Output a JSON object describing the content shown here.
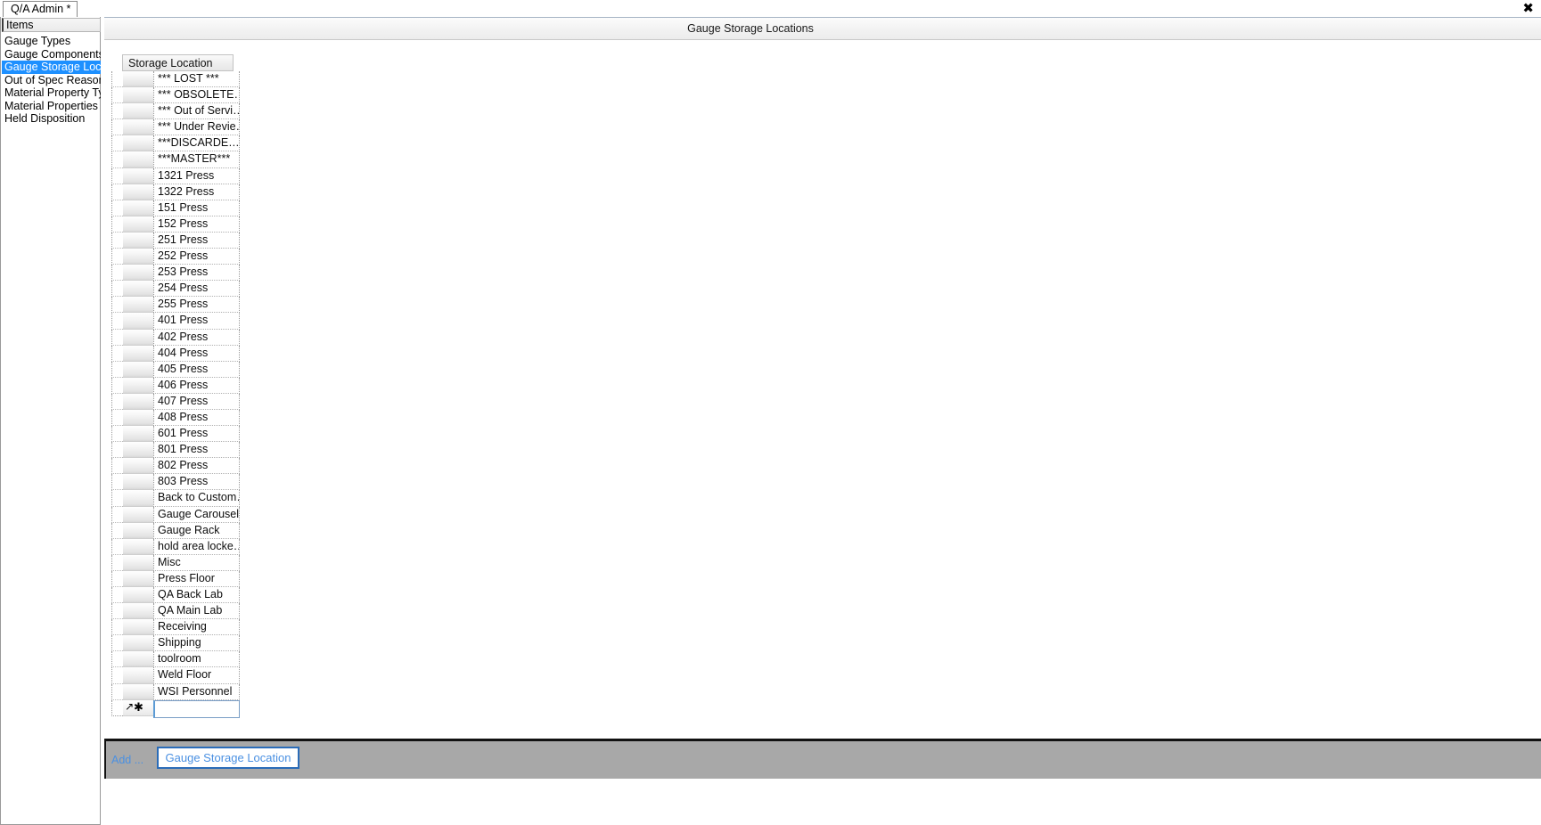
{
  "window": {
    "close_icon": "✖"
  },
  "tabs": [
    {
      "label": "Q/A Admin *"
    }
  ],
  "sidebar": {
    "header": "Items",
    "items": [
      {
        "label": "Gauge Types",
        "selected": false
      },
      {
        "label": "Gauge Components",
        "selected": false
      },
      {
        "label": "Gauge Storage Locations",
        "selected": true
      },
      {
        "label": "Out of Spec Reasons",
        "selected": false
      },
      {
        "label": "Material Property Types",
        "selected": false
      },
      {
        "label": "Material Properties",
        "selected": false
      },
      {
        "label": "Held Disposition",
        "selected": false
      }
    ]
  },
  "main": {
    "title": "Gauge Storage Locations",
    "grid": {
      "column_header": "Storage Location",
      "rows": [
        "*** LOST ***",
        "***  OBSOLETE…",
        "***  Out of  Servi…",
        "***  Under  Revie…",
        "***DISCARDE…",
        "***MASTER***",
        "1321 Press",
        "1322 Press",
        "151 Press",
        "152 Press",
        "251 Press",
        "252 Press",
        "253 Press",
        "254 Press",
        "255 Press",
        "401 Press",
        "402 Press",
        "404 Press",
        "405 Press",
        "406 Press",
        "407 Press",
        "408 Press",
        "601 Press",
        "801 Press",
        "802 Press",
        "803 Press",
        "Back to Custom…",
        "Gauge Carousel",
        "Gauge Rack",
        "hold  area  locke…",
        "Misc",
        "Press Floor",
        "QA Back Lab",
        "QA Main Lab",
        "Receiving",
        "Shipping",
        "toolroom",
        "Weld Floor",
        "WSI Personnel"
      ],
      "new_row": {
        "indicator": "✱",
        "cursor_icon": "➘",
        "value": "",
        "placeholder": ""
      }
    },
    "action_bar": {
      "add_label": "Add ...",
      "add_button": "Gauge Storage Location"
    }
  },
  "colors": {
    "selection_blue": "#1e90ff",
    "link_blue": "#4a90e2",
    "button_border": "#2b6cb8",
    "action_bar_gray": "#a8a8a8"
  }
}
